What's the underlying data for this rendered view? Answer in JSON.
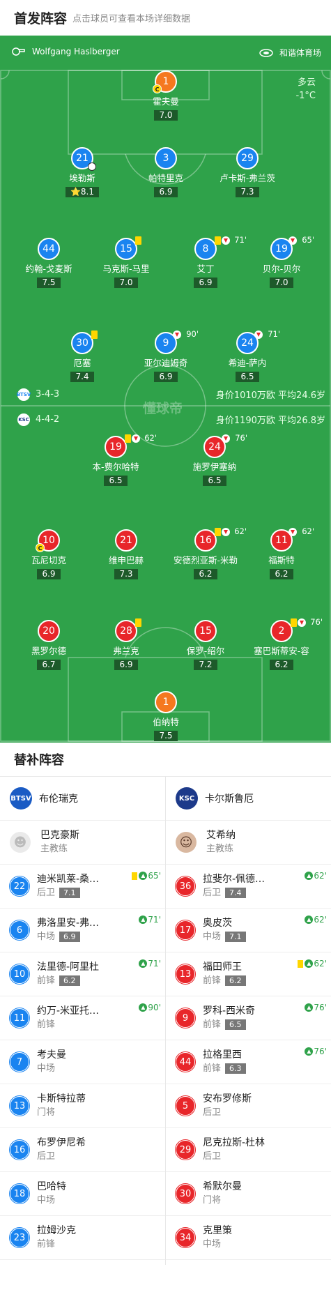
{
  "header": {
    "title": "首发阵容",
    "subtitle": "点击球员可查看本场详细数据"
  },
  "match": {
    "referee": "Wolfgang Haslberger",
    "venue": "和谐体育场",
    "weather": "多云",
    "temperature": "-1°C",
    "watermark": "懂球帝"
  },
  "home_team": {
    "formation": "3-4-3",
    "value_text": "身价1010万欧 平均24.6岁",
    "color": "#1a84f0",
    "lineup": [
      {
        "num": "1",
        "name": "霍夫曼",
        "rating": "7.0",
        "captain": "C"
      },
      {
        "num": "21",
        "name": "埃勒斯",
        "rating": "⭐8.1"
      },
      {
        "num": "3",
        "name": "帕特里克",
        "rating": "6.9"
      },
      {
        "num": "29",
        "name": "卢卡斯-弗兰茨",
        "rating": "7.3"
      },
      {
        "num": "44",
        "name": "约翰-戈麦斯",
        "rating": "7.5"
      },
      {
        "num": "15",
        "name": "马克斯-马里",
        "rating": "7.0"
      },
      {
        "num": "8",
        "name": "艾丁",
        "rating": "6.9",
        "sub": "71'"
      },
      {
        "num": "19",
        "name": "贝尔-贝尔",
        "rating": "7.0",
        "sub": "65'"
      },
      {
        "num": "30",
        "name": "厄塞",
        "rating": "7.4"
      },
      {
        "num": "9",
        "name": "亚尔迪姆奇",
        "rating": "6.9",
        "sub": "90'"
      },
      {
        "num": "24",
        "name": "希迪-萨内",
        "rating": "6.5",
        "sub": "71'"
      }
    ]
  },
  "away_team": {
    "formation": "4-4-2",
    "value_text": "身价1190万欧 平均26.8岁",
    "color": "#e8262a",
    "lineup": [
      {
        "num": "19",
        "name": "本-费尔哈特",
        "rating": "6.5",
        "sub": "62'"
      },
      {
        "num": "24",
        "name": "施罗伊塞纳",
        "rating": "6.5",
        "sub": "76'"
      },
      {
        "num": "10",
        "name": "瓦尼切克",
        "rating": "6.9",
        "captain": "C"
      },
      {
        "num": "21",
        "name": "维申巴赫",
        "rating": "7.3"
      },
      {
        "num": "16",
        "name": "安德烈亚斯-米勒",
        "rating": "6.2",
        "sub": "62'"
      },
      {
        "num": "11",
        "name": "福斯特",
        "rating": "6.2",
        "sub": "62'"
      },
      {
        "num": "20",
        "name": "黑罗尔德",
        "rating": "6.7"
      },
      {
        "num": "28",
        "name": "弗兰克",
        "rating": "6.9"
      },
      {
        "num": "15",
        "name": "保罗-绍尔",
        "rating": "7.2"
      },
      {
        "num": "2",
        "name": "塞巴斯蒂安-容",
        "rating": "6.2",
        "sub": "76'"
      },
      {
        "num": "1",
        "name": "伯纳特",
        "rating": "7.5"
      }
    ]
  },
  "subs": {
    "title": "替补阵容",
    "home": {
      "team_name": "布伦瑞克",
      "logo_text": "BTSV",
      "coach": {
        "name": "巴克豪斯",
        "role": "主教练"
      },
      "players": [
        {
          "num": "22",
          "name": "迪米凯莱-桑…",
          "pos": "后卫",
          "rating": "7.1",
          "time": "65'",
          "yellow": true
        },
        {
          "num": "6",
          "name": "弗洛里安-弗…",
          "pos": "中场",
          "rating": "6.9",
          "time": "71'"
        },
        {
          "num": "10",
          "name": "法里德-阿里杜",
          "pos": "前锋",
          "rating": "6.2",
          "time": "71'"
        },
        {
          "num": "11",
          "name": "约万-米亚托…",
          "pos": "前锋",
          "time": "90'"
        },
        {
          "num": "7",
          "name": "考夫曼",
          "pos": "中场"
        },
        {
          "num": "13",
          "name": "卡斯特拉蒂",
          "pos": "门将"
        },
        {
          "num": "16",
          "name": "布罗伊尼希",
          "pos": "后卫"
        },
        {
          "num": "18",
          "name": "巴哈特",
          "pos": "中场"
        },
        {
          "num": "23",
          "name": "拉姆沙克",
          "pos": "前锋"
        }
      ]
    },
    "away": {
      "team_name": "卡尔斯鲁厄",
      "logo_text": "KSC",
      "coach": {
        "name": "艾希纳",
        "role": "主教练"
      },
      "players": [
        {
          "num": "36",
          "name": "拉斐尔-佩德…",
          "pos": "后卫",
          "rating": "7.4",
          "time": "62'"
        },
        {
          "num": "17",
          "name": "奥皮茨",
          "pos": "中场",
          "rating": "7.1",
          "time": "62'"
        },
        {
          "num": "13",
          "name": "福田师王",
          "pos": "前锋",
          "rating": "6.2",
          "time": "62'",
          "yellow": true
        },
        {
          "num": "9",
          "name": "罗科-西米奇",
          "pos": "前锋",
          "rating": "6.5",
          "time": "76'"
        },
        {
          "num": "44",
          "name": "拉格里西",
          "pos": "前锋",
          "rating": "6.3",
          "time": "76'"
        },
        {
          "num": "5",
          "name": "安布罗修斯",
          "pos": "后卫"
        },
        {
          "num": "29",
          "name": "尼克拉斯-杜林",
          "pos": "后卫"
        },
        {
          "num": "30",
          "name": "希默尔曼",
          "pos": "门将"
        },
        {
          "num": "34",
          "name": "克里策",
          "pos": "中场"
        }
      ]
    }
  }
}
